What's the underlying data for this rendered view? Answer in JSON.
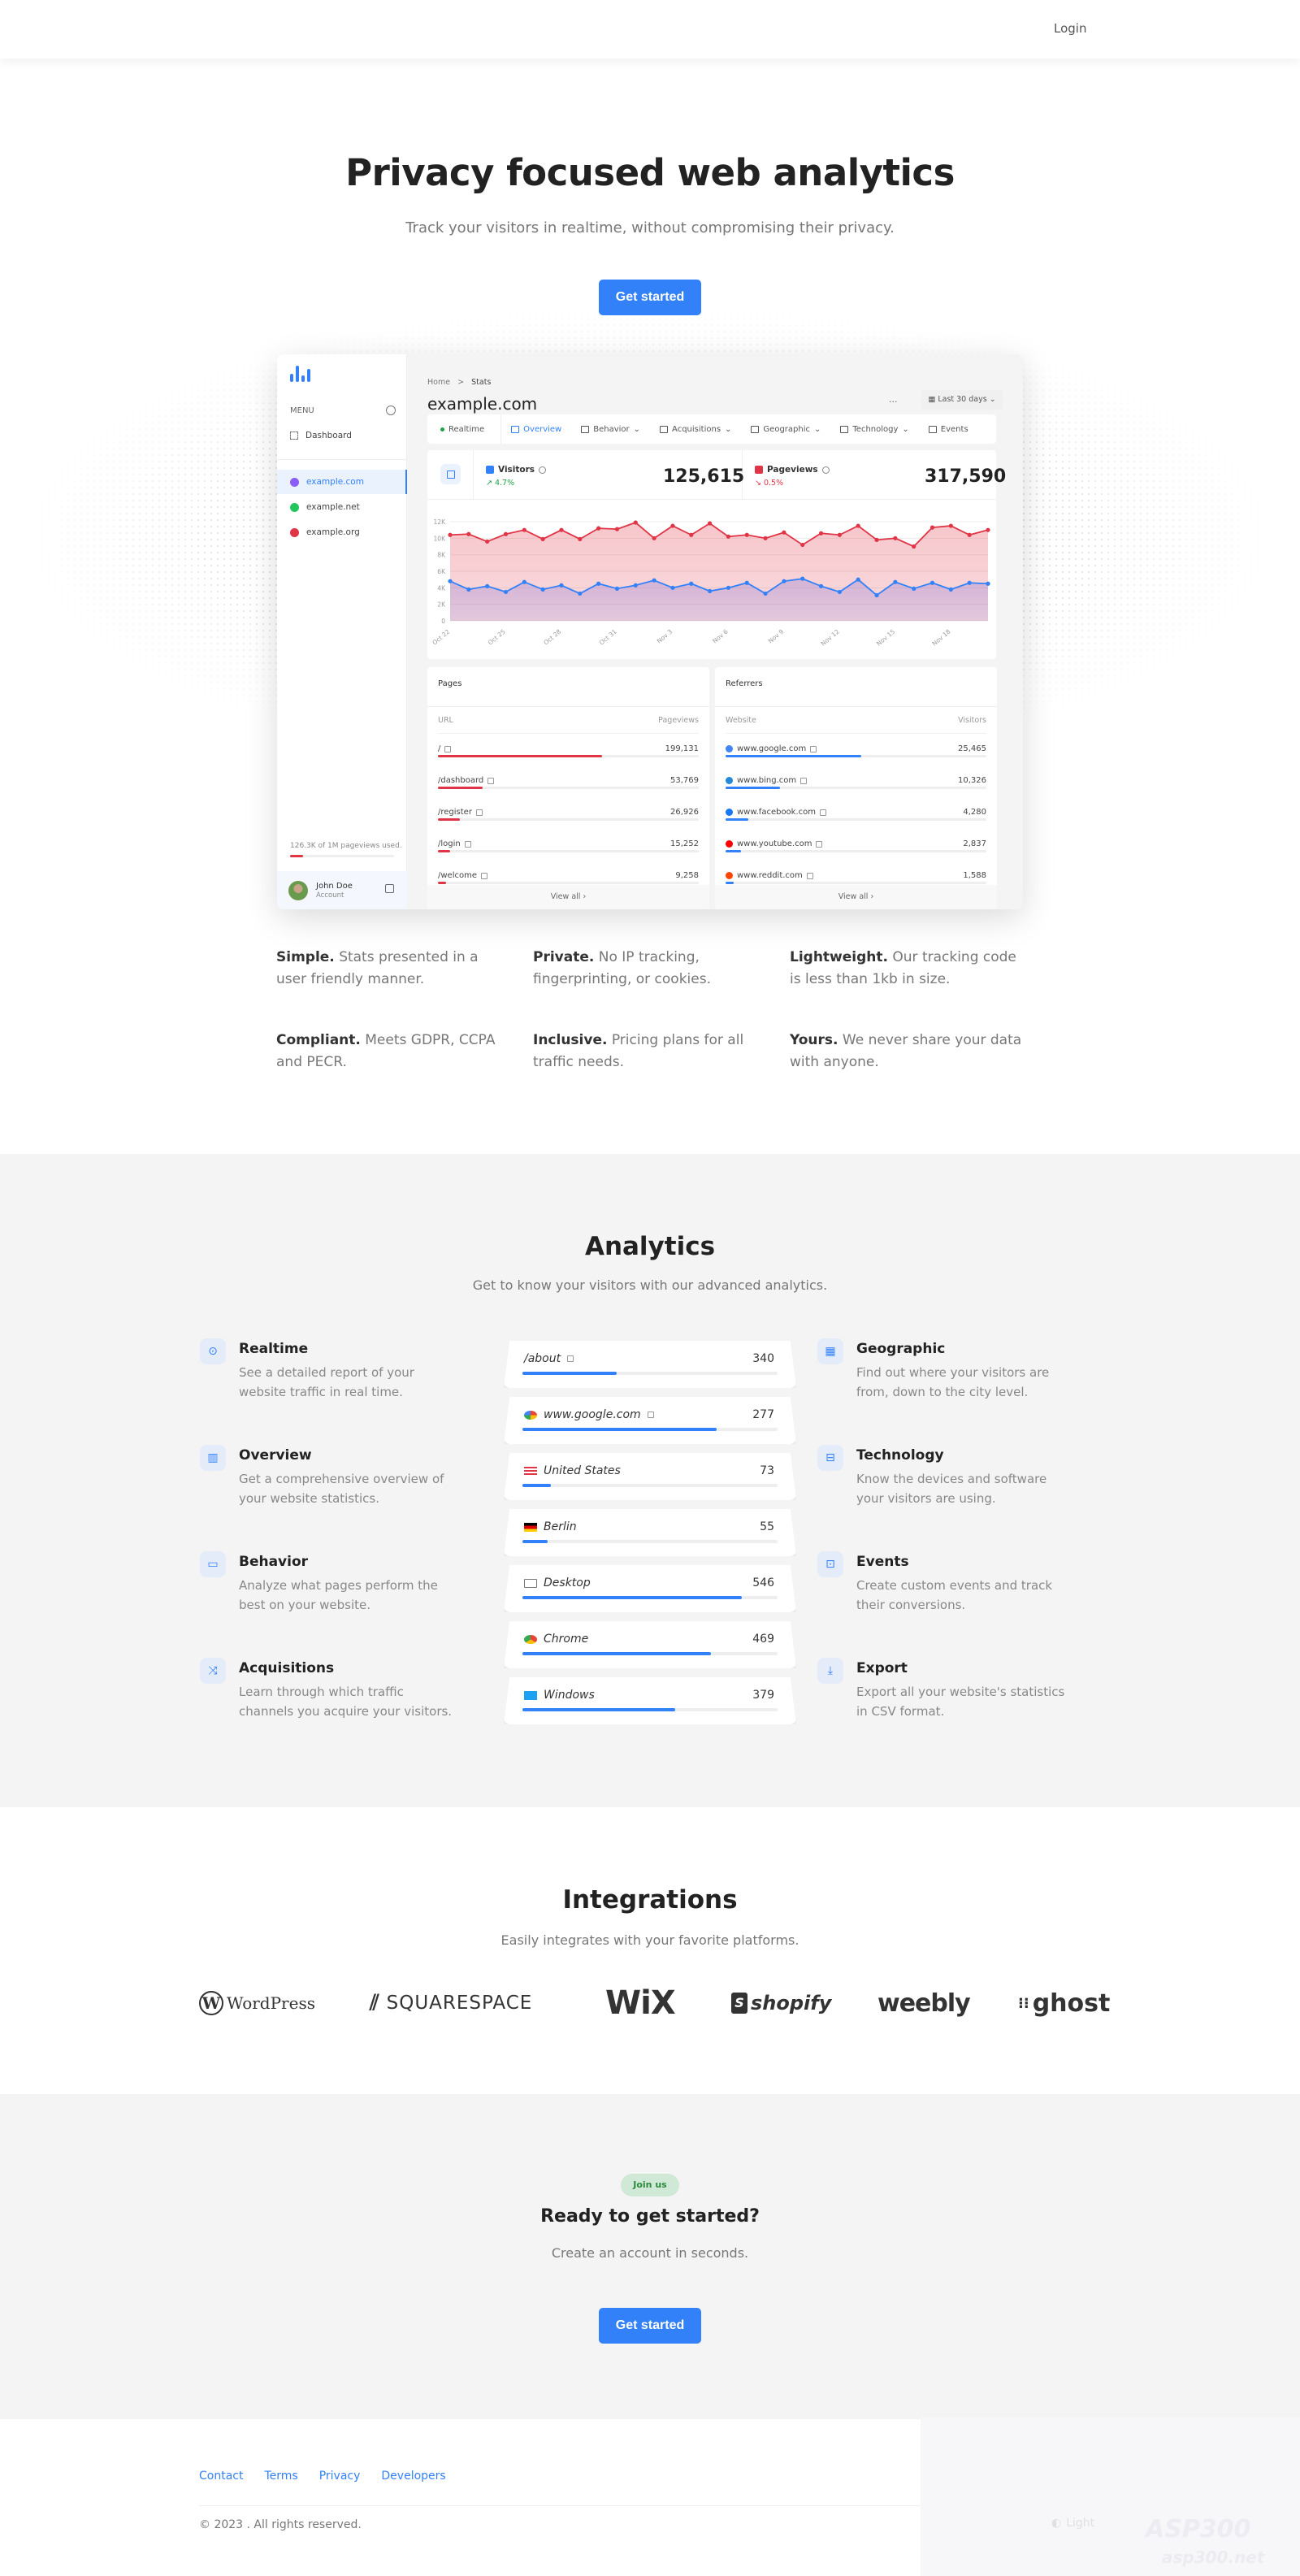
{
  "nav": {
    "login": "Login"
  },
  "hero": {
    "title": "Privacy focused web analytics",
    "subtitle": "Track your visitors in realtime, without compromising their privacy.",
    "cta": "Get started"
  },
  "dashboard": {
    "sidebar": {
      "menu_label": "MENU",
      "dashboard_label": "Dashboard",
      "sites": [
        {
          "name": "example.com",
          "color": "#8b5cf6",
          "active": true
        },
        {
          "name": "example.net",
          "color": "#22c55e",
          "active": false
        },
        {
          "name": "example.org",
          "color": "#e03546",
          "active": false
        }
      ],
      "usage_text": "126.3K of 1M pageviews used.",
      "usage_fraction": 0.126,
      "account_name": "John Doe",
      "account_sub": "Account"
    },
    "breadcrumb": {
      "home": "Home",
      "separator": ">",
      "current": "Stats"
    },
    "site_title": "example.com",
    "more": "···",
    "date_range": "Last 30 days",
    "tabs": [
      {
        "label": "Realtime",
        "icon": "dot-icon"
      },
      {
        "label": "Overview",
        "icon": "chart-icon",
        "active": true
      },
      {
        "label": "Behavior",
        "icon": "window-icon",
        "dropdown": true
      },
      {
        "label": "Acquisitions",
        "icon": "branch-icon",
        "dropdown": true
      },
      {
        "label": "Geographic",
        "icon": "map-icon",
        "dropdown": true
      },
      {
        "label": "Technology",
        "icon": "devices-icon",
        "dropdown": true
      },
      {
        "label": "Events",
        "icon": "target-icon"
      }
    ],
    "metrics": {
      "visitors": {
        "label": "Visitors",
        "delta": "4.7%",
        "direction": "up",
        "value": "125,615",
        "color": "#3281f9",
        "delta_color": "#20a04a"
      },
      "pageviews": {
        "label": "Pageviews",
        "delta": "0.5%",
        "direction": "down",
        "value": "317,590",
        "color": "#e03546",
        "delta_color": "#e03546"
      }
    },
    "pages": {
      "title": "Pages",
      "col_left": "URL",
      "col_right": "Pageviews",
      "rows": [
        {
          "label": "/",
          "value": "199,131",
          "fraction": 0.63
        },
        {
          "label": "/dashboard",
          "value": "53,769",
          "fraction": 0.17
        },
        {
          "label": "/register",
          "value": "26,926",
          "fraction": 0.085
        },
        {
          "label": "/login",
          "value": "15,252",
          "fraction": 0.048
        },
        {
          "label": "/welcome",
          "value": "9,258",
          "fraction": 0.03
        }
      ],
      "view_all": "View all"
    },
    "referrers": {
      "title": "Referrers",
      "col_left": "Website",
      "col_right": "Visitors",
      "rows": [
        {
          "label": "www.google.com",
          "value": "25,465",
          "fraction": 0.52,
          "icon": "google-icon",
          "color": "#4285f4"
        },
        {
          "label": "www.bing.com",
          "value": "10,326",
          "fraction": 0.21,
          "icon": "bing-icon",
          "color": "#2589d9"
        },
        {
          "label": "www.facebook.com",
          "value": "4,280",
          "fraction": 0.087,
          "icon": "facebook-icon",
          "color": "#1877f2"
        },
        {
          "label": "www.youtube.com",
          "value": "2,837",
          "fraction": 0.058,
          "icon": "youtube-icon",
          "color": "#ff0000"
        },
        {
          "label": "www.reddit.com",
          "value": "1,588",
          "fraction": 0.032,
          "icon": "reddit-icon",
          "color": "#ff4500"
        }
      ],
      "view_all": "View all"
    }
  },
  "chart_data": {
    "type": "area",
    "title": "",
    "xlabel": "",
    "ylabel": "",
    "ylim": [
      0,
      12000
    ],
    "yticks": [
      "0",
      "2K",
      "4K",
      "6K",
      "8K",
      "10K",
      "12K"
    ],
    "x": [
      "Oct 22",
      "Oct 23",
      "Oct 24",
      "Oct 25",
      "Oct 26",
      "Oct 27",
      "Oct 28",
      "Oct 29",
      "Oct 30",
      "Oct 31",
      "Nov 1",
      "Nov 2",
      "Nov 3",
      "Nov 4",
      "Nov 5",
      "Nov 6",
      "Nov 7",
      "Nov 8",
      "Nov 9",
      "Nov 10",
      "Nov 11",
      "Nov 12",
      "Nov 13",
      "Nov 14",
      "Nov 15",
      "Nov 16",
      "Nov 17",
      "Nov 18",
      "Nov 19",
      "Nov 20"
    ],
    "xtick_labels": [
      "Oct 22",
      "Oct 25",
      "Oct 28",
      "Oct 31",
      "Nov 3",
      "Nov 6",
      "Nov 9",
      "Nov 12",
      "Nov 15",
      "Nov 18"
    ],
    "grid": true,
    "legend": "none",
    "series": [
      {
        "name": "Pageviews",
        "color": "#e03546",
        "values": [
          10400,
          10500,
          9600,
          10500,
          11000,
          9900,
          11000,
          9900,
          11200,
          11100,
          11900,
          10000,
          11500,
          10400,
          11800,
          10200,
          10400,
          10000,
          10700,
          9200,
          10600,
          10400,
          11500,
          9800,
          10000,
          9000,
          11300,
          11500,
          10400,
          11000
        ]
      },
      {
        "name": "Visitors",
        "color": "#3281f9",
        "values": [
          4800,
          3800,
          4200,
          3500,
          4700,
          3800,
          4300,
          3300,
          4500,
          3900,
          4300,
          4900,
          4000,
          4500,
          3600,
          4000,
          4600,
          3300,
          4800,
          5100,
          4200,
          3500,
          5000,
          3100,
          4700,
          3900,
          4600,
          3800,
          4600,
          4500
        ]
      }
    ]
  },
  "features": [
    {
      "title": "Simple.",
      "text": "Stats presented in a user friendly manner."
    },
    {
      "title": "Private.",
      "text": "No IP tracking, fingerprinting, or cookies."
    },
    {
      "title": "Lightweight.",
      "text": "Our tracking code is less than 1kb in size."
    },
    {
      "title": "Compliant.",
      "text": "Meets GDPR, CCPA and PECR."
    },
    {
      "title": "Inclusive.",
      "text": "Pricing plans for all traffic needs."
    },
    {
      "title": "Yours.",
      "text": "We never share your data with anyone."
    }
  ],
  "analytics": {
    "title": "Analytics",
    "subtitle": "Get to know your visitors with our advanced analytics.",
    "left": [
      {
        "title": "Realtime",
        "text": "See a detailed report of your website traffic in real time.",
        "icon": "target-icon",
        "glyph": "⊙"
      },
      {
        "title": "Overview",
        "text": "Get a comprehensive overview of your website statistics.",
        "icon": "chart-icon",
        "glyph": "▥"
      },
      {
        "title": "Behavior",
        "text": "Analyze what pages perform the best on your website.",
        "icon": "window-icon",
        "glyph": "▭"
      },
      {
        "title": "Acquisitions",
        "text": "Learn through which traffic channels you acquire your visitors.",
        "icon": "branch-icon",
        "glyph": "⤨"
      }
    ],
    "right": [
      {
        "title": "Geographic",
        "text": "Find out where your visitors are from, down to the city level.",
        "icon": "map-icon",
        "glyph": "▦"
      },
      {
        "title": "Technology",
        "text": "Know the devices and software your visitors are using.",
        "icon": "devices-icon",
        "glyph": "⊟"
      },
      {
        "title": "Events",
        "text": "Create custom events and track their conversions.",
        "icon": "events-icon",
        "glyph": "⊡"
      },
      {
        "title": "Export",
        "text": "Export all your website's statistics in CSV format.",
        "icon": "download-icon",
        "glyph": "⤓"
      }
    ],
    "stack": [
      {
        "label": "/about",
        "value": "340",
        "fraction": 0.37,
        "icon": "external-link-icon"
      },
      {
        "label": "www.google.com",
        "value": "277",
        "fraction": 0.76,
        "icon": "google-icon"
      },
      {
        "label": "United States",
        "value": "73",
        "fraction": 0.11,
        "icon": "us-flag-icon"
      },
      {
        "label": "Berlin",
        "value": "55",
        "fraction": 0.1,
        "icon": "de-flag-icon"
      },
      {
        "label": "Desktop",
        "value": "546",
        "fraction": 0.86,
        "icon": "desktop-icon"
      },
      {
        "label": "Chrome",
        "value": "469",
        "fraction": 0.74,
        "icon": "chrome-icon"
      },
      {
        "label": "Windows",
        "value": "379",
        "fraction": 0.6,
        "icon": "windows-icon"
      }
    ]
  },
  "integrations": {
    "title": "Integrations",
    "subtitle": "Easily integrates with your favorite platforms.",
    "logos": [
      "WordPress",
      "SQUARESPACE",
      "WiX",
      "shopify",
      "weebly",
      "ghost"
    ]
  },
  "cta": {
    "badge": "Join us",
    "title": "Ready to get started?",
    "subtitle": "Create an account in seconds.",
    "button": "Get started"
  },
  "footer": {
    "links": [
      "Contact",
      "Terms",
      "Privacy",
      "Developers"
    ],
    "copyright": "© 2023 . All rights reserved.",
    "theme_toggle": "Light",
    "watermark": "ASP300",
    "watermark_sub": "asp300.net"
  },
  "colors": {
    "accent": "#3281f9",
    "danger": "#e03546",
    "success": "#20a04a"
  }
}
